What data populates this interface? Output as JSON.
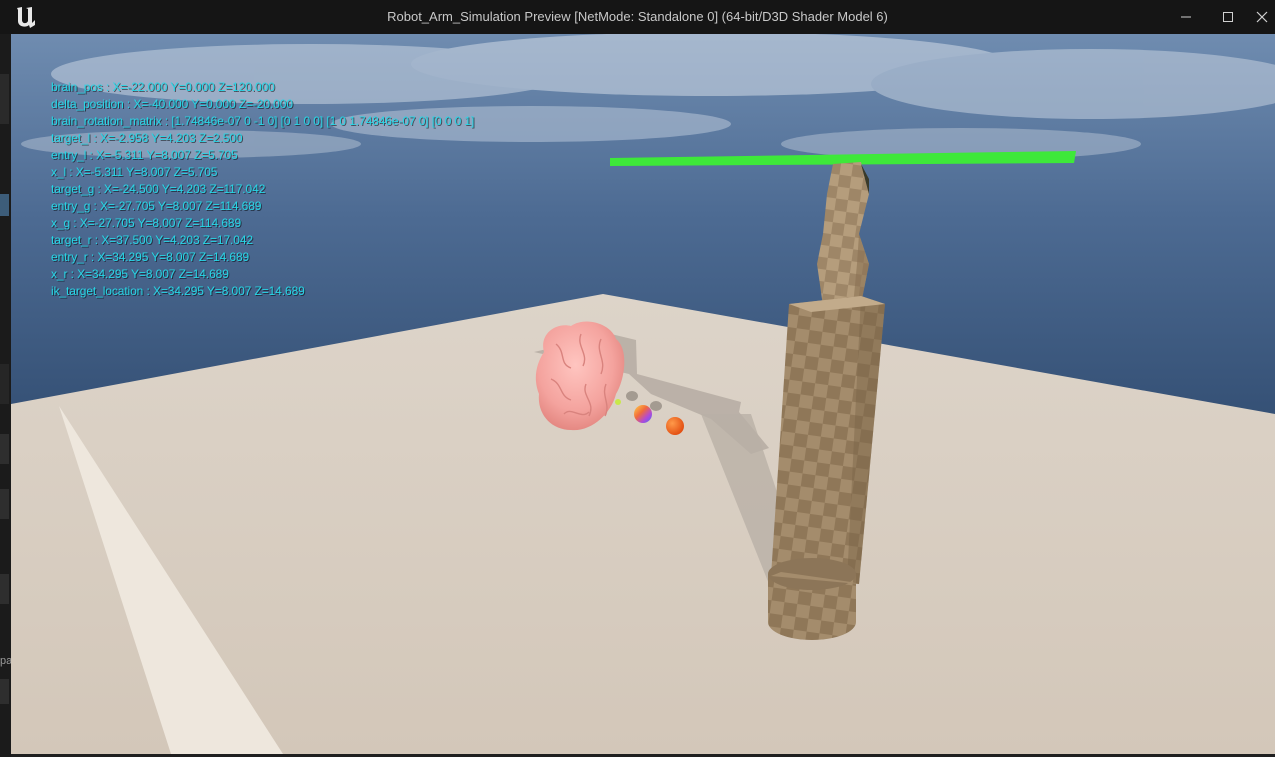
{
  "window": {
    "title": "Robot_Arm_Simulation Preview [NetMode: Standalone 0]  (64-bit/D3D Shader Model 6)",
    "logo_icon": "unreal-engine-logo-icon",
    "controls": {
      "minimize_icon": "minimize-icon",
      "maximize_icon": "maximize-icon",
      "close_icon": "close-icon"
    }
  },
  "left_strip": {
    "partial_text": "pa"
  },
  "debug_lines": [
    "brain_pos : X=-22.000 Y=0.000 Z=120.000",
    "delta_position : X=-40.000 Y=0.000 Z=-20.000",
    "brain_rotation_matrix : [1.74846e-07 0 -1 0] [0 1 0 0] [1 0 1.74846e-07 0] [0 0 0 1]",
    "target_l : X=-2.958 Y=4.203 Z=2.500",
    "entry_l : X=-5.311 Y=8.007 Z=5.705",
    "x_l : X=-5.311 Y=8.007 Z=5.705",
    "target_g : X=-24.500 Y=4.203 Z=117.042",
    "entry_g : X=-27.705 Y=8.007 Z=114.689",
    "x_g : X=-27.705 Y=8.007 Z=114.689",
    "target_r : X=37.500 Y=4.203 Z=17.042",
    "entry_r : X=34.295 Y=8.007 Z=14.689",
    "x_r : X=34.295 Y=8.007 Z=14.689",
    "ik_target_location : X=34.295 Y=8.007 Z=14.689"
  ],
  "colors": {
    "debug_text": "#27d6e6",
    "sky_top": "#4f6f97",
    "floor": "#d9cfc4",
    "green_bar": "#3ee83a",
    "brain": "#f4a7a3",
    "robot_arm": "#a48c6c",
    "orange_sphere": "#f26b1d",
    "titlebar_bg": "#151515"
  },
  "scene_objects": {
    "brain_icon": "brain-mesh-icon",
    "robot_arm_icon": "robot-arm-mesh-icon",
    "target_marker_icon": "target-sphere-icon"
  }
}
